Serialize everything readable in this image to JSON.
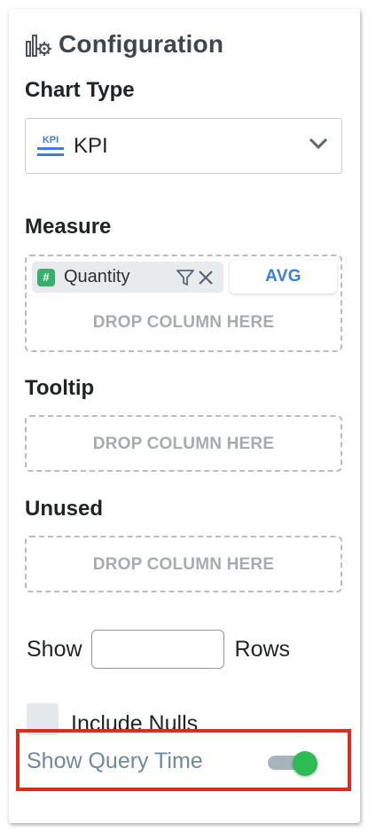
{
  "header": {
    "title": "Configuration",
    "icon": "chart-settings-icon"
  },
  "chart_type": {
    "label": "Chart Type",
    "selected": "KPI",
    "icon_text": "KPI",
    "icon": "kpi-icon"
  },
  "measure": {
    "label": "Measure",
    "column": {
      "name": "Quantity",
      "type_symbol": "#",
      "aggregation": "AVG"
    },
    "drop_text": "DROP COLUMN HERE"
  },
  "tooltip": {
    "label": "Tooltip",
    "drop_text": "DROP COLUMN HERE"
  },
  "unused": {
    "label": "Unused",
    "drop_text": "DROP COLUMN HERE"
  },
  "rows": {
    "prefix": "Show",
    "suffix": "Rows",
    "value": ""
  },
  "include_nulls": {
    "label": "Include Nulls",
    "checked": false
  },
  "show_query_time": {
    "label": "Show Query Time",
    "enabled": true
  },
  "colors": {
    "accent": "#3c7fd6",
    "toggle_on": "#2dbb54",
    "highlight": "#dd2b1e",
    "numeric_badge": "#37b06d"
  }
}
